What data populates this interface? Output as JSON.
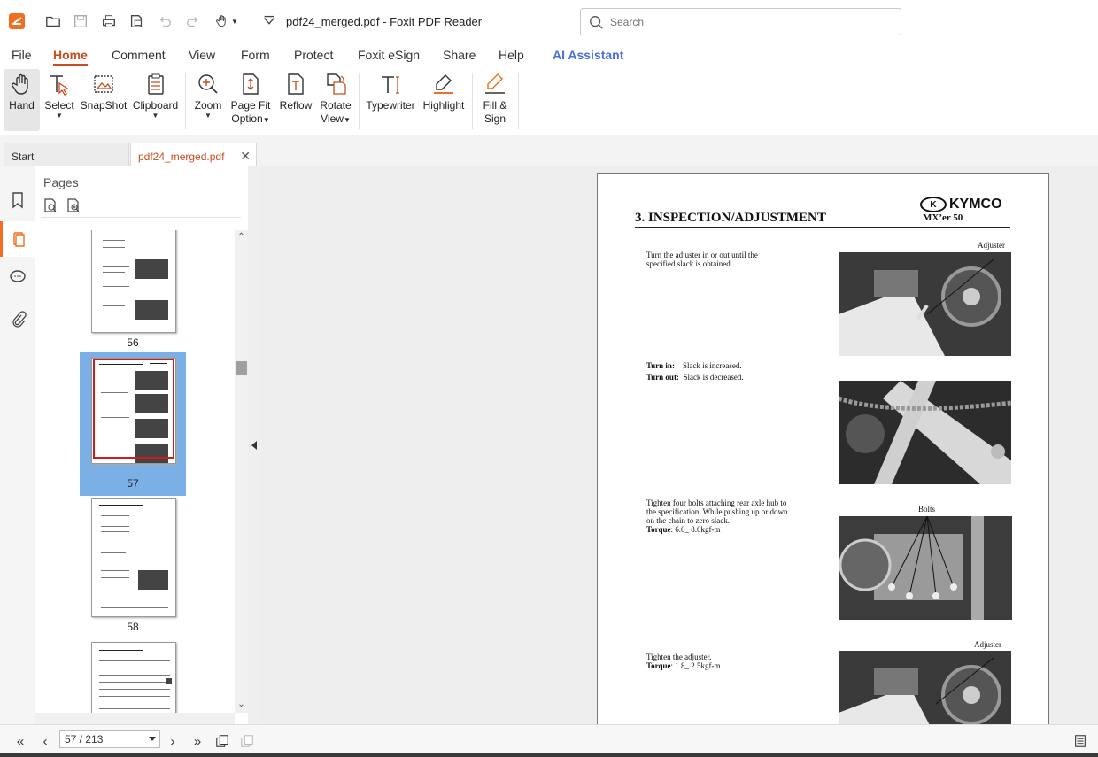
{
  "app": {
    "window_title": "pdf24_merged.pdf - Foxit PDF Reader",
    "search_placeholder": "Search"
  },
  "menu": {
    "tabs": [
      "File",
      "Home",
      "Comment",
      "View",
      "Form",
      "Protect",
      "Foxit eSign",
      "Share",
      "Help",
      "AI Assistant"
    ],
    "active": "Home"
  },
  "ribbon": {
    "hand": "Hand",
    "select": "Select",
    "snapshot": "SnapShot",
    "clipboard": "Clipboard",
    "zoom": "Zoom",
    "page_fit_1": "Page Fit",
    "page_fit_2": "Option",
    "reflow": "Reflow",
    "rotate_1": "Rotate",
    "rotate_2": "View",
    "typewriter": "Typewriter",
    "highlight": "Highlight",
    "fill_1": "Fill &",
    "fill_2": "Sign"
  },
  "doc_tabs": {
    "start": "Start",
    "file": "pdf24_merged.pdf"
  },
  "pages_panel": {
    "title": "Pages",
    "thumbs": [
      "56",
      "57",
      "58"
    ],
    "selected": "57"
  },
  "page": {
    "heading": "3. INSPECTION/ADJUSTMENT",
    "brand": "KYMCO",
    "model": "MX’er 50",
    "text1_a": "Turn the adjuster in or out until the",
    "text1_b": "specified slack is obtained.",
    "turn_in_label": "Turn in:",
    "turn_in_value": "Slack is increased.",
    "turn_out_label": "Turn out:",
    "turn_out_value": "Slack is decreased.",
    "text3_a": "Tighten four bolts attaching rear axle hub to",
    "text3_b": "the specification. While pushing up or down",
    "text3_c": "on the chain to zero slack.",
    "torque1_label": "Torque",
    "torque1_value": ": 6.0_ 8.0kgf-m",
    "text4": "Tighten the adjuster.",
    "torque2_label": "Torque",
    "torque2_value": ": 1.8_ 2.5kgf-m",
    "label_adjuster": "Adjuster",
    "label_bolts": "Bolts"
  },
  "status": {
    "page_indicator": "57 / 213"
  },
  "colors": {
    "accent": "#c94d1f",
    "selection": "#7ab0e6",
    "ai": "#4a6ee0"
  }
}
